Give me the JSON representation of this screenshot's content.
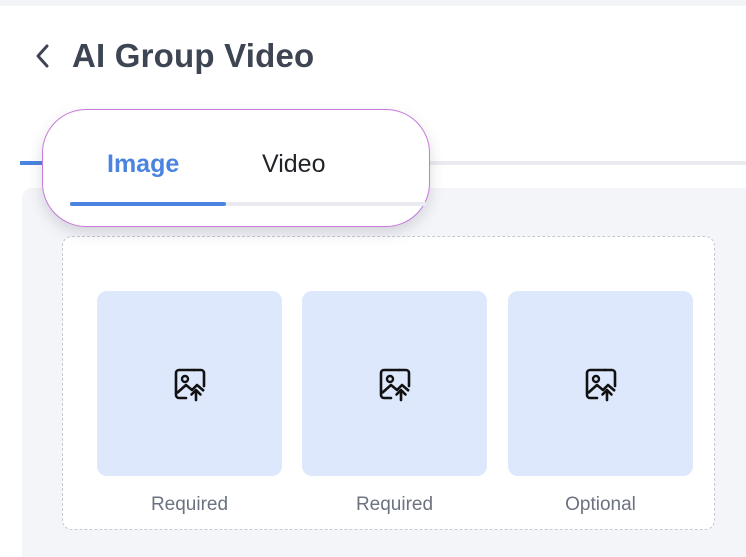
{
  "header": {
    "title": "AI Group Video",
    "back_icon": "chevron-left-icon"
  },
  "tabs": [
    {
      "label": "Image",
      "active": true
    },
    {
      "label": "Video",
      "active": false
    }
  ],
  "upload": {
    "slots": [
      {
        "icon": "image-upload-icon",
        "label": "Required"
      },
      {
        "icon": "image-upload-icon",
        "label": "Required"
      },
      {
        "icon": "image-upload-icon",
        "label": "Optional"
      }
    ]
  },
  "colors": {
    "accent": "#4a84e0",
    "title": "#3d4552",
    "tile_bg": "#dde8fc",
    "popup_border": "#c779dc"
  }
}
